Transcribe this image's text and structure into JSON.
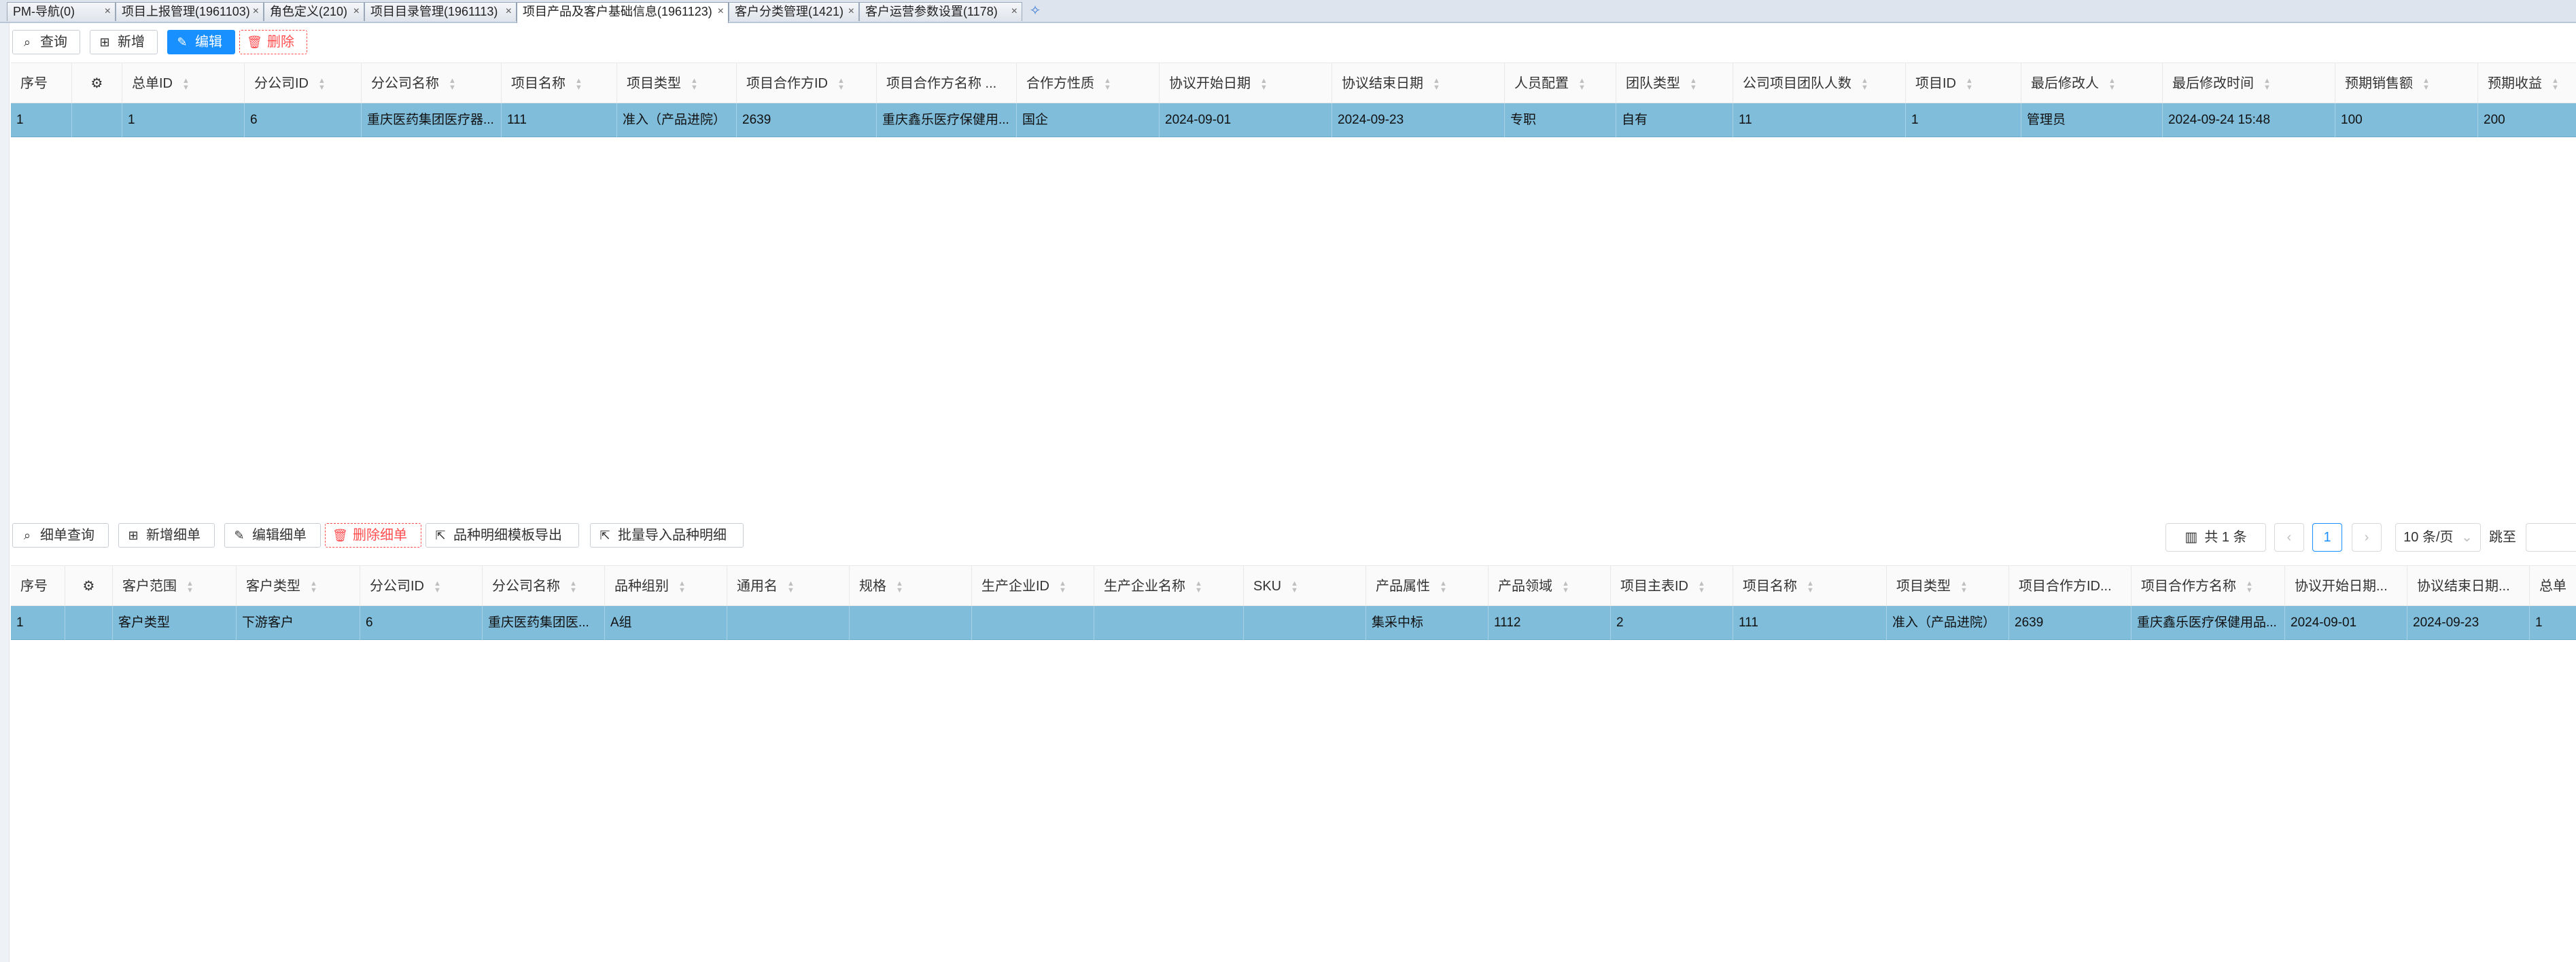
{
  "tabs": [
    {
      "label": "PM-导航(0)"
    },
    {
      "label": "项目上报管理(1961103)"
    },
    {
      "label": "角色定义(210)"
    },
    {
      "label": "项目目录管理(1961113)"
    },
    {
      "label": "项目产品及客户基础信息(1961123)"
    },
    {
      "label": "客户分类管理(1421)"
    },
    {
      "label": "客户运营参数设置(1178)"
    }
  ],
  "tab_close": "×",
  "tab_add": "✧",
  "top_toolbar": {
    "query": "查询",
    "add": "新增",
    "edit": "编辑",
    "delete": "删除"
  },
  "top_table": {
    "columns": [
      "序号",
      "",
      "总单ID",
      "分公司ID",
      "分公司名称",
      "项目名称",
      "项目类型",
      "项目合作方ID",
      "项目合作方名称 ...",
      "合作方性质",
      "协议开始日期",
      "协议结束日期",
      "人员配置",
      "团队类型",
      "公司项目团队人数",
      "项目ID",
      "最后修改人",
      "最后修改时间",
      "预期销售额",
      "预期收益"
    ],
    "rows": [
      [
        "1",
        "",
        "1",
        "6",
        "重庆医药集团医疗器...",
        "111",
        "准入（产品进院）",
        "2639",
        "重庆鑫乐医疗保健用...",
        "国企",
        "2024-09-01",
        "2024-09-23",
        "专职",
        "自有",
        "11",
        "1",
        "管理员",
        "2024-09-24 15:48",
        "100",
        "200"
      ]
    ]
  },
  "bottom_toolbar": {
    "query": "细单查询",
    "add": "新增细单",
    "edit": "编辑细单",
    "delete": "删除细单",
    "export_template": "品种明细模板导出",
    "batch_import": "批量导入品种明细"
  },
  "pagination": {
    "total": "共 1 条",
    "prev": "‹",
    "current": "1",
    "next": "›",
    "page_size": "10 条/页",
    "goto": "跳至"
  },
  "bottom_table": {
    "columns": [
      "序号",
      "",
      "客户范围",
      "客户类型",
      "分公司ID",
      "分公司名称",
      "品种组别",
      "通用名",
      "规格",
      "生产企业ID",
      "生产企业名称",
      "SKU",
      "产品属性",
      "产品领域",
      "项目主表ID",
      "项目名称",
      "项目类型",
      "项目合作方ID...",
      "项目合作方名称",
      "协议开始日期...",
      "协议结束日期...",
      "总单"
    ],
    "rows": [
      [
        "1",
        "",
        "客户类型",
        "下游客户",
        "6",
        "重庆医药集团医...",
        "A组",
        "",
        "",
        "",
        "",
        "",
        "集采中标",
        "1112",
        "2",
        "111",
        "准入（产品进院）",
        "2639",
        "重庆鑫乐医疗保健用品...",
        "2024-09-01",
        "2024-09-23",
        "1"
      ]
    ]
  },
  "colors": {
    "primary": "#1890ff",
    "danger": "#ff4d4f",
    "selected_row": "#7fbddb"
  },
  "icons": {
    "search": "search-icon",
    "add": "plus-square-icon",
    "edit": "edit-icon",
    "delete": "trash-icon",
    "settings": "gear-icon",
    "export": "export-icon",
    "chart": "bar-chart-icon",
    "chevron": "chevron-down-icon"
  }
}
